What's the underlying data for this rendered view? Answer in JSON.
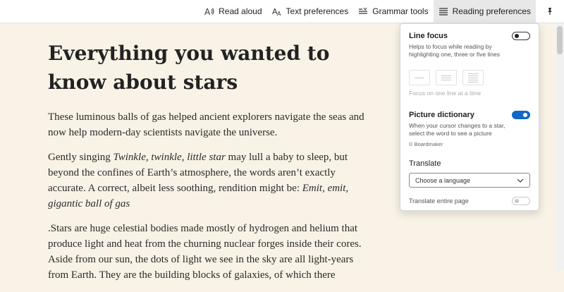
{
  "toolbar": {
    "read_aloud": "Read aloud",
    "text_preferences": "Text preferences",
    "grammar_tools": "Grammar tools",
    "reading_preferences": "Reading preferences"
  },
  "article": {
    "title": "Everything you wanted to know about stars",
    "p1": "These luminous balls of gas helped ancient explorers navigate the seas and now help modern-day scientists navigate the universe.",
    "p2_a": "Gently singing ",
    "p2_i1": "Twinkle, twinkle, little star",
    "p2_b": " may lull a baby to sleep, but beyond the confines of Earth’s atmosphere, the words aren’t exactly accurate. A correct, albeit less soothing, rendition might be: ",
    "p2_i2": "Emit, emit, gigantic ball of gas",
    "p3": ".Stars are huge celestial bodies made mostly of hydrogen and helium that produce light and heat from the churning nuclear forges inside their cores. Aside from our sun, the dots of light we see in the sky are all light-years from Earth. They are the building blocks of galaxies, of which there"
  },
  "panel": {
    "line_focus": {
      "title": "Line focus",
      "desc": "Helps to focus while reading by highlighting one, three or five lines",
      "enabled": false,
      "hint": "Focus on one line at a time"
    },
    "picture_dictionary": {
      "title": "Picture dictionary",
      "desc": "When your cursor changes to a star, select the word to see a picture",
      "credit": "© Boardmaker",
      "enabled": true
    },
    "translate": {
      "title": "Translate",
      "select_value": "Choose a language",
      "entire_page_label": "Translate entire page",
      "entire_page_enabled": false
    }
  },
  "colors": {
    "background": "#f8f3e6",
    "accent": "#1168c8"
  }
}
